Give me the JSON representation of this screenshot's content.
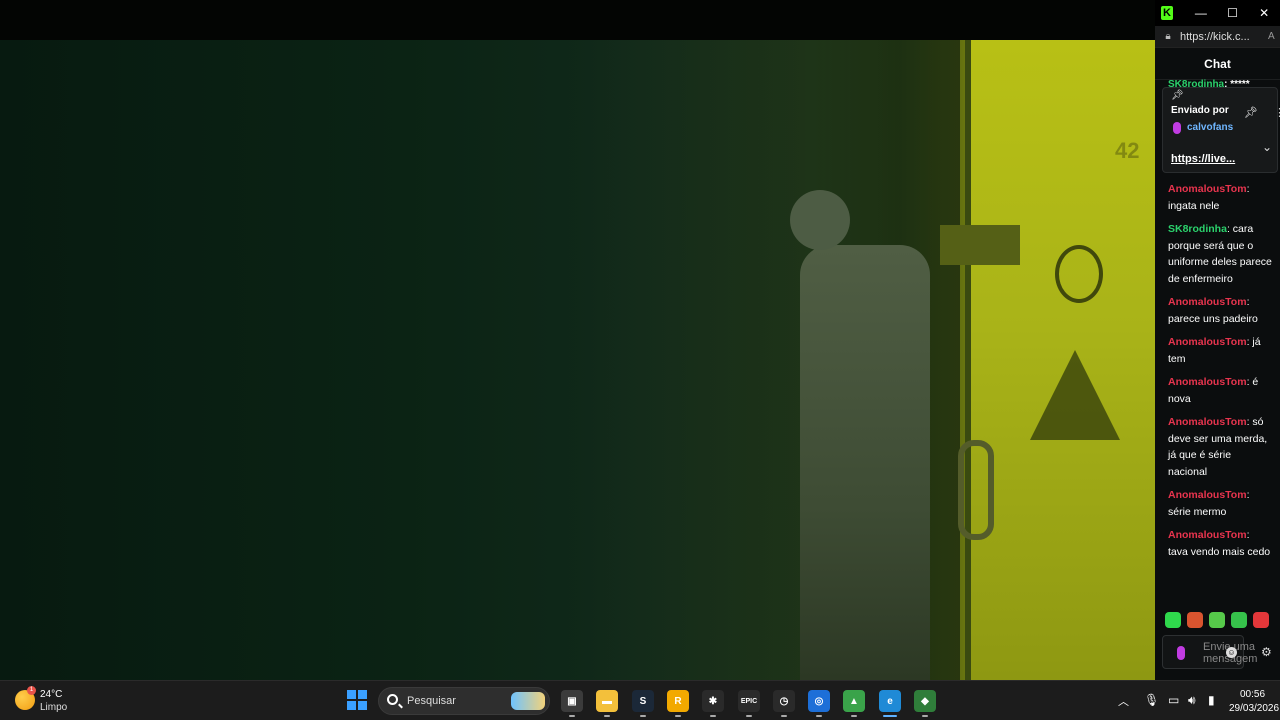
{
  "chat_window": {
    "url": "https://kick.c...",
    "title": "Chat",
    "minimize": "—",
    "maximize": "☐",
    "close": "✕",
    "pinned": {
      "peek_user": "SK8rodinha",
      "peek_text": ": *****",
      "label": "Enviado por",
      "user": "calvofans",
      "link": "https://live..."
    },
    "messages": [
      {
        "user": "AnomalousTom",
        "color": "#e8344e",
        "text": ": ingata nele"
      },
      {
        "user": "SK8rodinha",
        "color": "#2bd16c",
        "text": ": cara porque será que o uniforme deles parece de enfermeiro"
      },
      {
        "user": "AnomalousTom",
        "color": "#e8344e",
        "text": ": parece uns padeiro"
      },
      {
        "user": "AnomalousTom",
        "color": "#e8344e",
        "text": ": já tem"
      },
      {
        "user": "AnomalousTom",
        "color": "#e8344e",
        "text": ": é nova"
      },
      {
        "user": "AnomalousTom",
        "color": "#e8344e",
        "text": ": só deve ser uma merda, já que é série nacional"
      },
      {
        "user": "AnomalousTom",
        "color": "#e8344e",
        "text": ": série mermo"
      },
      {
        "user": "AnomalousTom",
        "color": "#e8344e",
        "text": ": tava vendo mais cedo"
      }
    ],
    "input_placeholder": "Envie uma mensagem",
    "emote_colors": [
      "#2fd84c",
      "#d9542f",
      "#56c94a",
      "#36c24b",
      "#e3373a"
    ]
  },
  "video": {
    "door_number": "42"
  },
  "taskbar": {
    "weather_temp": "24°C",
    "weather_desc": "Limpo",
    "weather_badge": "1",
    "search_placeholder": "Pesquisar",
    "apps": [
      {
        "name": "task-view",
        "glyph": "▣",
        "color": "#3b3b3b"
      },
      {
        "name": "file-explorer",
        "glyph": "▬",
        "color": "#f3c03b"
      },
      {
        "name": "steam",
        "glyph": "S",
        "color": "#1b2838"
      },
      {
        "name": "rockstar",
        "glyph": "R",
        "color": "#f2a900"
      },
      {
        "name": "spider",
        "glyph": "✱",
        "color": "#2a2a2a"
      },
      {
        "name": "epic-games",
        "glyph": "EPIC",
        "color": "#2a2a2a"
      },
      {
        "name": "clock-app",
        "glyph": "◷",
        "color": "#2a2a2a"
      },
      {
        "name": "app-blue",
        "glyph": "◎",
        "color": "#1d6fd8"
      },
      {
        "name": "app-green",
        "glyph": "▲",
        "color": "#3aa34a"
      },
      {
        "name": "edge",
        "glyph": "e",
        "color": "#1f8ad6"
      },
      {
        "name": "bluestacks",
        "glyph": "◆",
        "color": "#2f7d3a"
      }
    ],
    "time": "00:56",
    "date": "29/03/2026"
  }
}
